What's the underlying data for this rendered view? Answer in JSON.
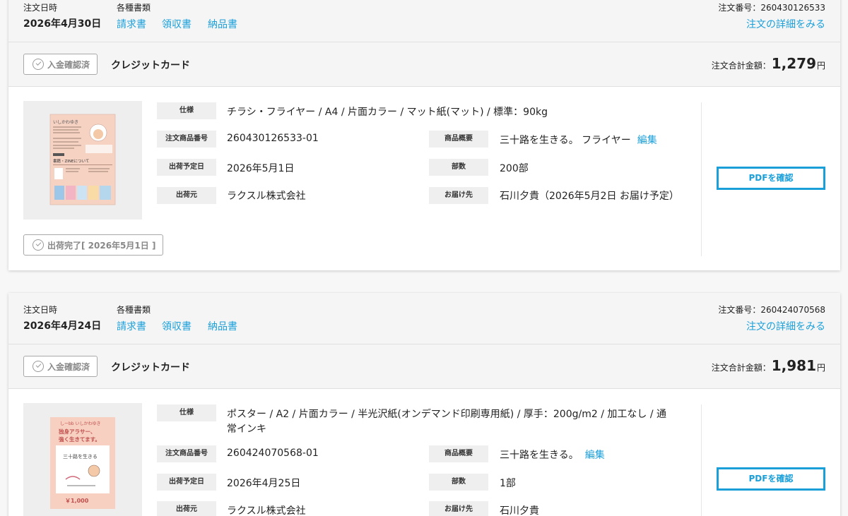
{
  "orders": [
    {
      "date_label": "注文日時",
      "date": "2026年4月30日",
      "docs_label": "各種書類",
      "docs": [
        "請求書",
        "領収書",
        "納品書"
      ],
      "order_no": "注文番号：260430126533",
      "detail_link": "注文の詳細をみる",
      "payment_status": "入金確認済",
      "payment_method": "クレジットカード",
      "total_label": "注文合計金額：",
      "total_value": "1,279",
      "total_unit": "円",
      "item": {
        "spec_label": "仕様",
        "spec": "チラシ・フライヤー / A4 / 片面カラー / マット紙(マット) / 標準：90kg",
        "item_no_label": "注文商品番号",
        "item_no": "260430126533-01",
        "summary_label": "商品概要",
        "summary": "三十路を生きる。 フライヤー",
        "edit": "編集",
        "ship_date_label": "出荷予定日",
        "ship_date": "2026年5月1日",
        "qty_label": "部数",
        "qty": "200部",
        "shipper_label": "出荷元",
        "shipper": "ラクスル株式会社",
        "dest_label": "お届け先",
        "dest": "石川夕貴（2026年5月2日 お届け予定）",
        "pdf_button": "PDFを確認",
        "ship_status": "出荷完了[ 2026年5月1日 ]"
      }
    },
    {
      "date_label": "注文日時",
      "date": "2026年4月24日",
      "docs_label": "各種書類",
      "docs": [
        "請求書",
        "領収書",
        "納品書"
      ],
      "order_no": "注文番号：260424070568",
      "detail_link": "注文の詳細をみる",
      "payment_status": "入金確認済",
      "payment_method": "クレジットカード",
      "total_label": "注文合計金額：",
      "total_value": "1,981",
      "total_unit": "円",
      "item": {
        "spec_label": "仕様",
        "spec_line1": "ポスター / A2 / 片面カラー / 半光沢紙(オンデマンド印刷専用紙) / 厚手：200g/m2 / 加工なし / 通",
        "spec_line2": "常インキ",
        "item_no_label": "注文商品番号",
        "item_no": "260424070568-01",
        "summary_label": "商品概要",
        "summary": "三十路を生きる。",
        "edit": "編集",
        "ship_date_label": "出荷予定日",
        "ship_date": "2026年4月25日",
        "qty_label": "部数",
        "qty": "1部",
        "shipper_label": "出荷元",
        "shipper": "ラクスル株式会社",
        "dest_label": "お届け先",
        "dest": "石川夕貴",
        "pdf_button": "PDFを確認",
        "thumb_text": {
          "author": "しーbb いしかわゆき",
          "headline_1": "独身アラサー、",
          "headline_2": "強く生きてます。",
          "book_title": "三十路を生きる",
          "price": "￥1,000"
        }
      }
    }
  ],
  "colors": {
    "link": "#1a9fd9",
    "header_bg": "#f5f5f5",
    "label_bg": "#efefef"
  }
}
